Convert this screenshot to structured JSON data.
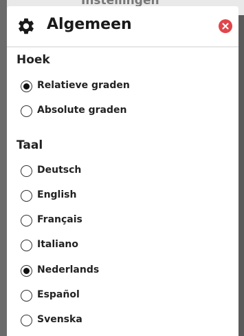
{
  "background": {
    "title": "Instellingen"
  },
  "panel": {
    "title": "Algemeen",
    "icons": {
      "header": "gear-icon",
      "close": "close-icon"
    },
    "colors": {
      "close": "#e0454a",
      "divider": "#e6e6e6"
    }
  },
  "angle": {
    "title": "Hoek",
    "options": [
      {
        "label": "Relatieve graden",
        "checked": true
      },
      {
        "label": "Absolute graden",
        "checked": false
      }
    ]
  },
  "language": {
    "title": "Taal",
    "options": [
      {
        "label": "Deutsch",
        "checked": false
      },
      {
        "label": "English",
        "checked": false
      },
      {
        "label": "Français",
        "checked": false
      },
      {
        "label": "Italiano",
        "checked": false
      },
      {
        "label": "Nederlands",
        "checked": true
      },
      {
        "label": "Español",
        "checked": false
      },
      {
        "label": "Svenska",
        "checked": false
      }
    ]
  }
}
